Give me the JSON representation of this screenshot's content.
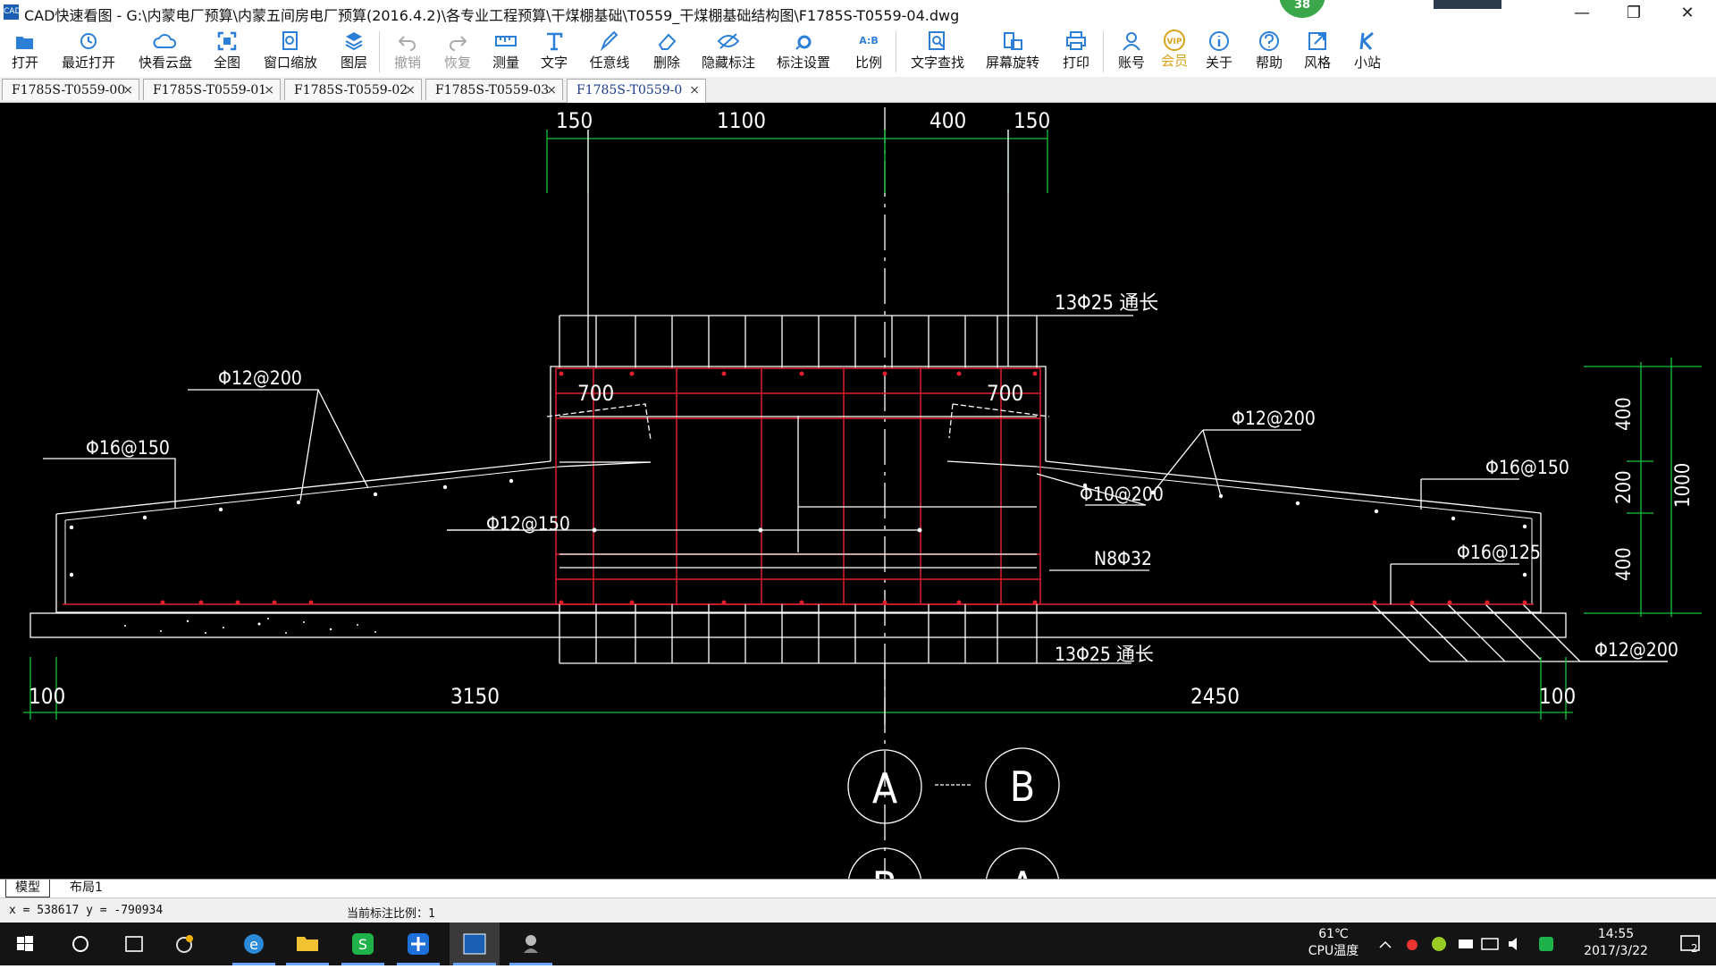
{
  "window": {
    "title": "CAD快速看图 - G:\\内蒙电厂预算\\内蒙五间房电厂预算(2016.4.2)\\各专业工程预算\\干煤棚基础\\T0559_干煤棚基础结构图\\F1785S-T0559-04.dwg",
    "app_icon_text": "CAD",
    "notification_badge": "38",
    "minimize": "—",
    "restore": "❐",
    "close": "✕"
  },
  "toolbar": {
    "buttons": [
      {
        "label": "打开",
        "icon": "folder-open-icon"
      },
      {
        "label": "最近打开",
        "icon": "recent-icon"
      },
      {
        "label": "快看云盘",
        "icon": "cloud-icon"
      },
      {
        "label": "全图",
        "icon": "fit-all-icon"
      },
      {
        "label": "窗口缩放",
        "icon": "zoom-window-icon"
      },
      {
        "label": "图层",
        "icon": "layers-icon"
      },
      {
        "label": "撤销",
        "icon": "undo-icon",
        "disabled": true
      },
      {
        "label": "恢复",
        "icon": "redo-icon",
        "disabled": true
      },
      {
        "label": "测量",
        "icon": "measure-icon"
      },
      {
        "label": "文字",
        "icon": "text-icon"
      },
      {
        "label": "任意线",
        "icon": "pencil-icon"
      },
      {
        "label": "删除",
        "icon": "eraser-icon"
      },
      {
        "label": "隐藏标注",
        "icon": "eye-hide-icon"
      },
      {
        "label": "标注设置",
        "icon": "annotation-settings-icon"
      },
      {
        "label": "比例",
        "icon": "scale-icon"
      },
      {
        "label": "文字查找",
        "icon": "text-search-icon"
      },
      {
        "label": "屏幕旋转",
        "icon": "rotate-screen-icon"
      },
      {
        "label": "打印",
        "icon": "print-icon"
      },
      {
        "label": "账号",
        "icon": "account-icon"
      },
      {
        "label": "会员",
        "icon": "vip-icon"
      },
      {
        "label": "关于",
        "icon": "info-icon"
      },
      {
        "label": "帮助",
        "icon": "help-icon"
      },
      {
        "label": "风格",
        "icon": "style-icon"
      },
      {
        "label": "小站",
        "icon": "k-station-icon"
      }
    ],
    "vip_icon_text": "VIP",
    "scale_icon_text": "A:B"
  },
  "file_tabs": [
    {
      "label": "F1785S-T0559-00",
      "active": false
    },
    {
      "label": "F1785S-T0559-01",
      "active": false
    },
    {
      "label": "F1785S-T0559-02",
      "active": false
    },
    {
      "label": "F1785S-T0559-03",
      "active": false
    },
    {
      "label": "F1785S-T0559-0",
      "active": true
    }
  ],
  "tab_close": "×",
  "drawing": {
    "dims_top": [
      "150",
      "1100",
      "400",
      "150"
    ],
    "dims_bottom": [
      "100",
      "3150",
      "2450",
      "100"
    ],
    "dims_right": [
      "400",
      "200",
      "400",
      "1000"
    ],
    "dim_700_left": "700",
    "dim_700_right": "700",
    "labels": {
      "top_rebar": "13Φ25 通长",
      "bottom_rebar": "13Φ25 通长",
      "phi12_200_left": "Φ12@200",
      "phi16_150_left": "Φ16@150",
      "phi12_150": "Φ12@150",
      "phi12_200_right": "Φ12@200",
      "phi16_150_right": "Φ16@150",
      "phi10_200": "Φ10@200",
      "n8_phi32": "N8Φ32",
      "phi16_125": "Φ16@125",
      "phi12_200_bottom": "Φ12@200"
    },
    "section_marks": [
      "A",
      "B",
      "B",
      "A"
    ],
    "colors": {
      "background": "#000000",
      "lines": "#ffffff",
      "rebar": "#e0202a",
      "dimension": "#19c23a"
    }
  },
  "sheet_tabs": [
    {
      "label": "模型",
      "active": true
    },
    {
      "label": "布局1",
      "active": false
    }
  ],
  "status": {
    "coords": "x = 538617 y = -790934",
    "scale_text": "当前标注比例：1"
  },
  "taskbar": {
    "apps": [
      "start-icon",
      "cortana-icon",
      "task-view-icon",
      "assistant-icon",
      "ie-icon",
      "explorer-icon",
      "wps-icon",
      "pinwheel-icon",
      "cad-viewer-icon",
      "game-icon"
    ],
    "temp": "61℃",
    "temp_label": "CPU温度",
    "time": "14:55",
    "date": "2017/3/22",
    "notifications": "2"
  }
}
